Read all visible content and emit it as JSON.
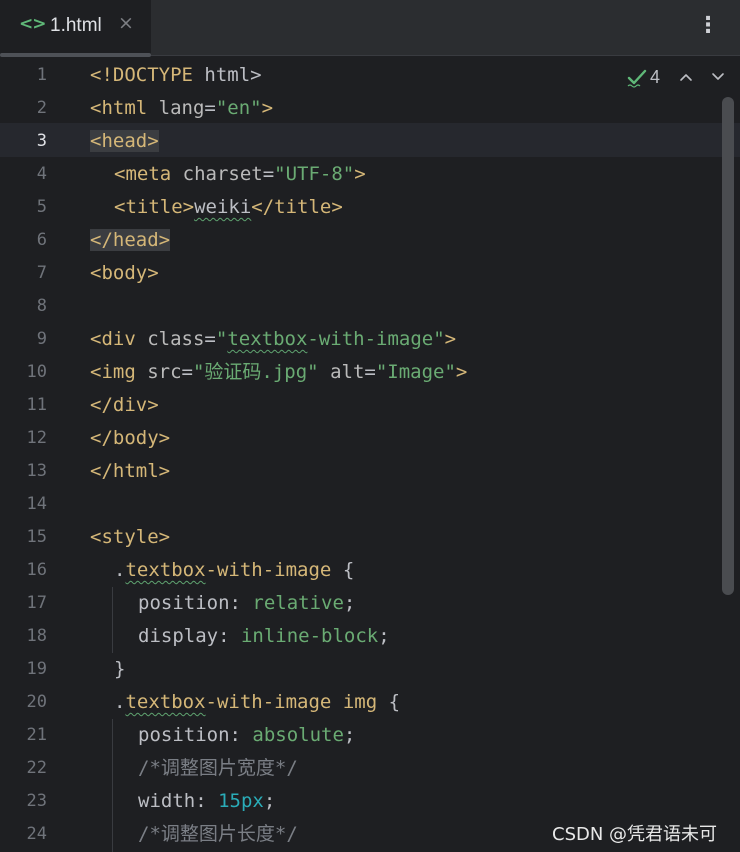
{
  "tab": {
    "icon": "html-code-icon",
    "icon_glyph": "<>",
    "filename": "1.html",
    "close_glyph": "×",
    "more_glyph": "⋮"
  },
  "inspection": {
    "count": "4",
    "status_color": "#5fb878"
  },
  "gutter": {
    "numbers": [
      "1",
      "2",
      "3",
      "4",
      "5",
      "6",
      "7",
      "8",
      "9",
      "10",
      "11",
      "12",
      "13",
      "14",
      "15",
      "16",
      "17",
      "18",
      "19",
      "20",
      "21",
      "22",
      "23",
      "24"
    ],
    "active_line": "3"
  },
  "code": {
    "l1": {
      "open": "<!DOCTYPE",
      "rest": " html>"
    },
    "l2": {
      "tag": "<html",
      "attr": " lang",
      "eq": "=",
      "val": "\"en\"",
      "close": ">"
    },
    "l3": {
      "tag": "<head>"
    },
    "l4": {
      "tag": "<meta",
      "attr": " charset",
      "eq": "=",
      "val": "\"UTF-8\"",
      "close": ">"
    },
    "l5": {
      "open": "<title>",
      "text": "weiki",
      "close": "</title>"
    },
    "l6": {
      "tag": "</head>"
    },
    "l7": {
      "tag": "<body>"
    },
    "l9": {
      "tag": "<div",
      "attr": " class",
      "eq": "=",
      "q1": "\"",
      "val": "textbox",
      "val2": "-with-image\"",
      "close": ">"
    },
    "l10": {
      "tag": "<img",
      "attr": " src",
      "eq": "=",
      "val": "\"验证码.jpg\"",
      "attr2": " alt",
      "eq2": "=",
      "val2": "\"Image\"",
      "close": ">"
    },
    "l11": {
      "tag": "</div>"
    },
    "l12": {
      "tag": "</body>"
    },
    "l13": {
      "tag": "</html>"
    },
    "l15": {
      "tag": "<style>"
    },
    "l16": {
      "dot": ".",
      "cls": "textbox",
      "rest": "-with-image",
      "brace": " {"
    },
    "l17": {
      "prop": "position",
      "colon": ": ",
      "val": "relative",
      "semi": ";"
    },
    "l18": {
      "prop": "display",
      "colon": ": ",
      "val": "inline-block",
      "semi": ";"
    },
    "l19": {
      "brace": "}"
    },
    "l20": {
      "dot": ".",
      "cls": "textbox",
      "rest": "-with-image",
      "tag": " img",
      "brace": " {"
    },
    "l21": {
      "prop": "position",
      "colon": ": ",
      "val": "absolute",
      "semi": ";"
    },
    "l22": {
      "comment": "/*调整图片宽度*/"
    },
    "l23": {
      "prop": "width",
      "colon": ": ",
      "num": "15px",
      "semi": ";"
    },
    "l24": {
      "comment": "/*调整图片长度*/"
    }
  },
  "watermark": "CSDN @凭君语未可"
}
